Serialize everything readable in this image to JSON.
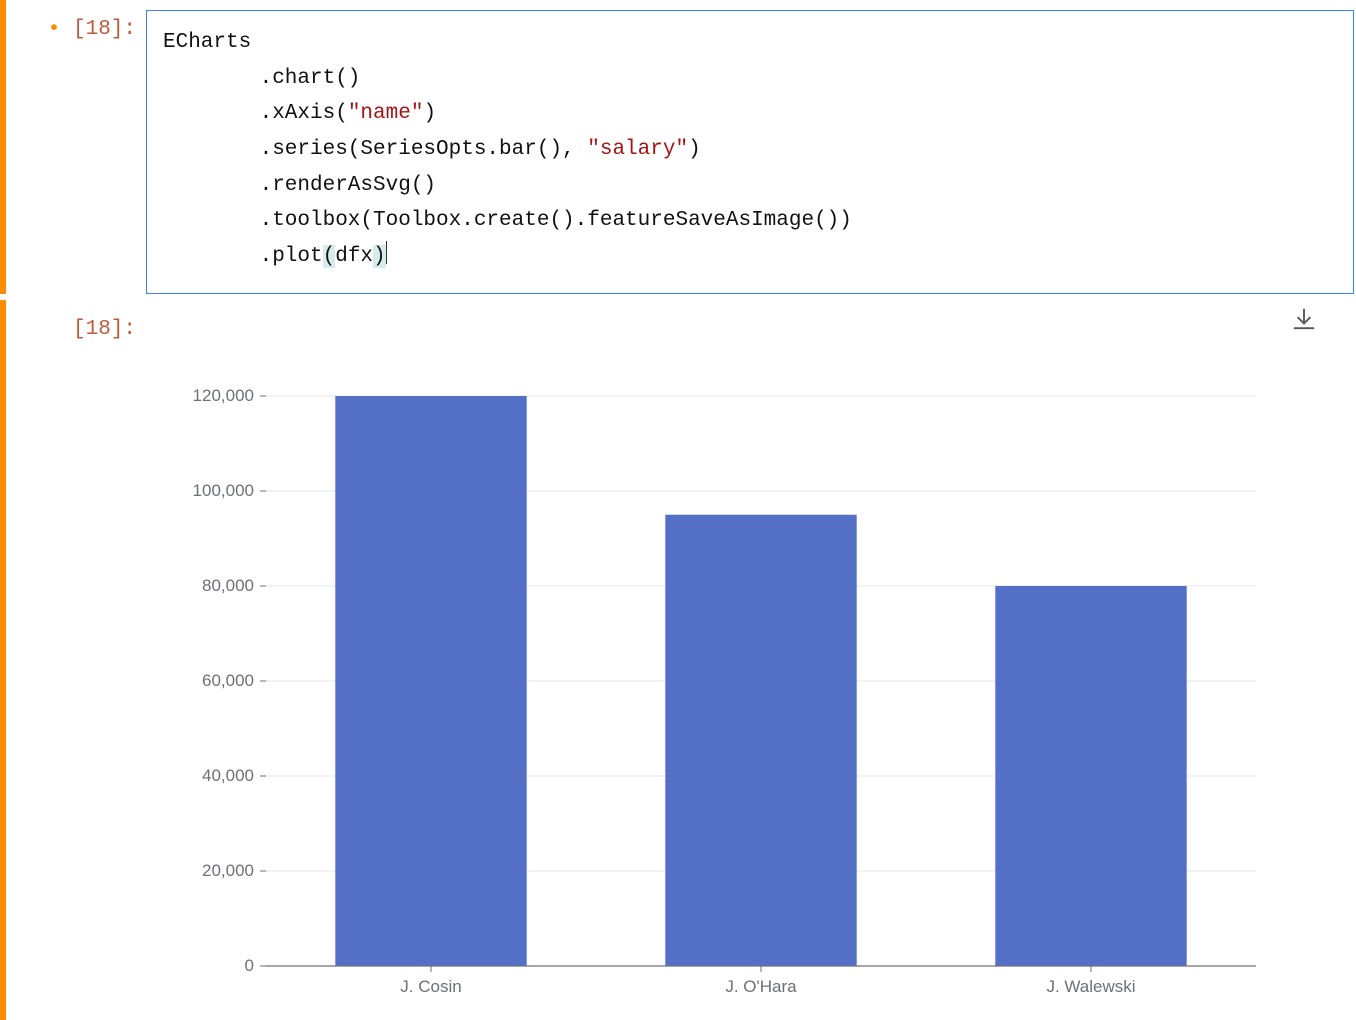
{
  "input_cell": {
    "prompt": "[18]:",
    "modified": true,
    "code": {
      "line1": "ECharts",
      "line2_a": ".chart()",
      "line3_a": ".xAxis(",
      "line3_str": "\"name\"",
      "line3_b": ")",
      "line4_a": ".series(SeriesOpts.bar(), ",
      "line4_str": "\"salary\"",
      "line4_b": ")",
      "line5": ".renderAsSvg()",
      "line6": ".toolbox(Toolbox.create().featureSaveAsImage())",
      "line7_a": ".plot",
      "line7_paren_open": "(",
      "line7_var": "dfx",
      "line7_paren_close": ")"
    }
  },
  "output_cell": {
    "prompt": "[18]:"
  },
  "toolbox": {
    "save_as_image_tooltip": "Save as Image"
  },
  "chart_data": {
    "type": "bar",
    "categories": [
      "J. Cosin",
      "J. O'Hara",
      "J. Walewski"
    ],
    "values": [
      120000,
      95000,
      80000
    ],
    "series_name": "salary",
    "xlabel": "",
    "ylabel": "",
    "ylim": [
      0,
      120000
    ],
    "y_ticks": [
      0,
      20000,
      40000,
      60000,
      80000,
      100000,
      120000
    ],
    "y_tick_labels": [
      "0",
      "20,000",
      "40,000",
      "60,000",
      "80,000",
      "100,000",
      "120,000"
    ],
    "bar_color": "#5470c6",
    "grid_color": "#e0e6ed",
    "tick_color": "#6e7079"
  }
}
